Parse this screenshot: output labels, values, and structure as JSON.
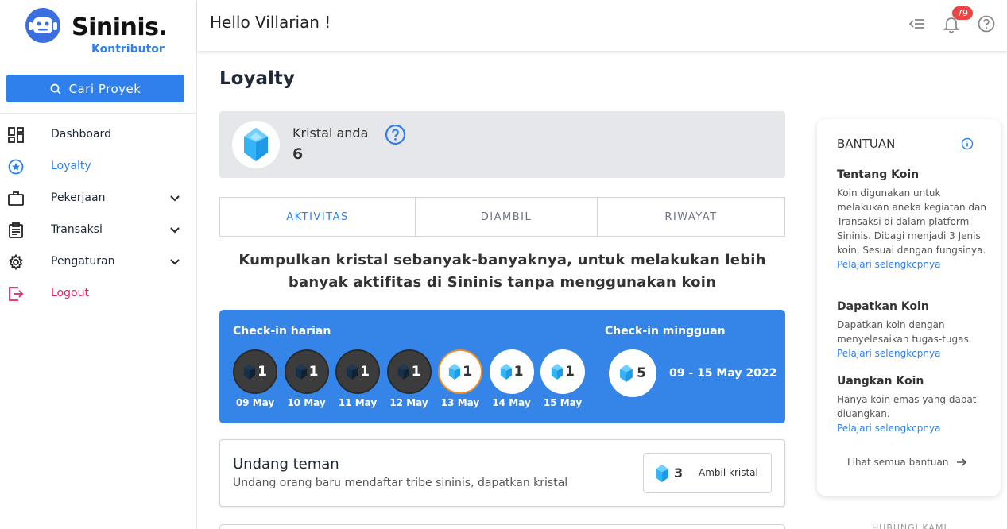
{
  "brand": {
    "name": "Sininis.",
    "subtitle": "Kontributor"
  },
  "search": {
    "label": "Cari Proyek"
  },
  "nav": [
    {
      "label": "Dashboard",
      "icon": "dashboard-icon"
    },
    {
      "label": "Loyalty",
      "icon": "star-icon",
      "active": true
    },
    {
      "label": "Pekerjaan",
      "icon": "briefcase-icon",
      "expandable": true
    },
    {
      "label": "Transaksi",
      "icon": "clipboard-icon",
      "expandable": true
    },
    {
      "label": "Pengaturan",
      "icon": "gear-icon",
      "expandable": true
    },
    {
      "label": "Logout",
      "icon": "logout-icon"
    }
  ],
  "header": {
    "greeting": "Hello Villarian !",
    "notification_count": "79"
  },
  "page": {
    "title": "Loyalty"
  },
  "crystal": {
    "label": "Kristal anda",
    "value": "6"
  },
  "tabs": [
    {
      "label": "AKTIVITAS",
      "active": true
    },
    {
      "label": "DIAMBIL"
    },
    {
      "label": "RIWAYAT"
    }
  ],
  "promo": {
    "line1": "Kumpulkan kristal sebanyak-banyaknya, untuk melakukan lebih",
    "line2": "banyak aktifitas di Sininis tanpa menggunakan koin"
  },
  "checkin": {
    "daily_title": "Check-in harian",
    "weekly_title": "Check-in mingguan",
    "days": [
      {
        "date": "09 May",
        "count": "1",
        "state": "past"
      },
      {
        "date": "10 May",
        "count": "1",
        "state": "past"
      },
      {
        "date": "11 May",
        "count": "1",
        "state": "past"
      },
      {
        "date": "12 May",
        "count": "1",
        "state": "past"
      },
      {
        "date": "13 May",
        "count": "1",
        "state": "today"
      },
      {
        "date": "14 May",
        "count": "1",
        "state": "future"
      },
      {
        "date": "15 May",
        "count": "1",
        "state": "future"
      }
    ],
    "weekly_count": "5",
    "weekly_range": "09 - 15 May 2022"
  },
  "invite": {
    "title": "Undang teman",
    "desc": "Undang orang baru mendaftar tribe sininis, dapatkan kristal",
    "reward": "3",
    "button": "Ambil kristal"
  },
  "help": {
    "title": "BANTUAN",
    "sections": [
      {
        "heading": "Tentang Koin",
        "body": "Koin digunakan untuk melakukan aneka kegiatan dan Transaksi di dalam platform Sininis. Dibagi menjadi 3 Jenis koin, Sesuai dengan fungsinya.",
        "link": "Pelajari selengkcpnya"
      },
      {
        "heading": "Dapatkan Koin",
        "body": "Dapatkan koin dengan menyelesaikan tugas-tugas.",
        "link": "Pelajari selengkcpnya"
      },
      {
        "heading": "Uangkan Koin",
        "body": "Hanya koin emas yang dapat diuangkan.",
        "link": "Pelajari selengkcpnya"
      }
    ],
    "all_link": "Lihat semua bantuan"
  },
  "footer_peek": "HUBUNGI KAMI",
  "colors": {
    "accent": "#2f80ed",
    "logout": "#e0245e",
    "badge": "#ef4444",
    "today_ring": "#f28c28"
  }
}
